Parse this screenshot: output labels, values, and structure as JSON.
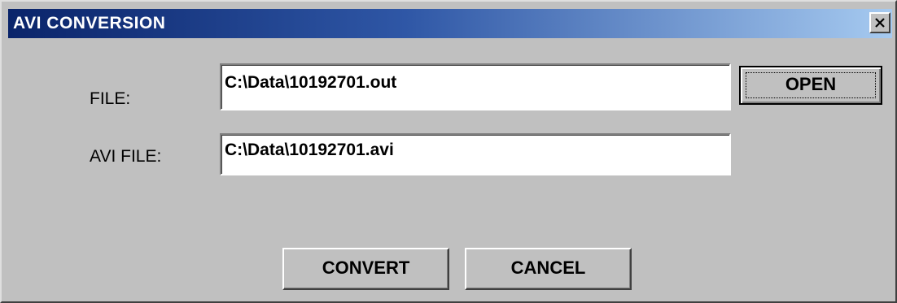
{
  "window": {
    "title": "AVI CONVERSION",
    "close_glyph": "✕"
  },
  "form": {
    "file_label": "FILE:",
    "file_value": "C:\\Data\\10192701.out",
    "avi_label": "AVI FILE:",
    "avi_value": "C:\\Data\\10192701.avi"
  },
  "buttons": {
    "open": "OPEN",
    "convert": "CONVERT",
    "cancel": "CANCEL"
  },
  "icons": {
    "close": "close-icon"
  },
  "colors": {
    "title_gradient_start": "#0a246a",
    "title_gradient_end": "#a6caf0",
    "face": "#c0c0c0"
  }
}
